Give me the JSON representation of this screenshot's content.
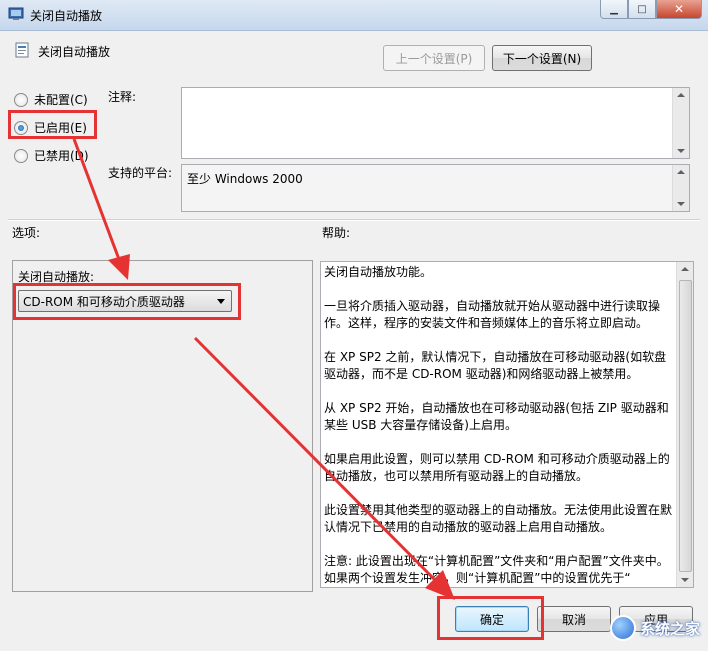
{
  "window": {
    "title": "关闭自动播放"
  },
  "header": {
    "policy_title": "关闭自动播放",
    "prev_label": "上一个设置(P)",
    "next_label": "下一个设置(N)"
  },
  "radios": [
    {
      "label": "未配置(C)",
      "checked": false
    },
    {
      "label": "已启用(E)",
      "checked": true
    },
    {
      "label": "已禁用(D)",
      "checked": false
    }
  ],
  "comment": {
    "label": "注释:",
    "value": ""
  },
  "platform": {
    "label": "支持的平台:",
    "value": "至少 Windows 2000"
  },
  "options": {
    "label": "选项:",
    "dropdown_label": "关闭自动播放:",
    "dropdown_value": "CD-ROM 和可移动介质驱动器"
  },
  "help": {
    "label": "帮助:",
    "paragraphs": [
      "关闭自动播放功能。",
      "一旦将介质插入驱动器，自动播放就开始从驱动器中进行读取操作。这样，程序的安装文件和音频媒体上的音乐将立即启动。",
      "在 XP SP2 之前，默认情况下，自动播放在可移动驱动器(如软盘驱动器，而不是 CD-ROM 驱动器)和网络驱动器上被禁用。",
      "从 XP SP2 开始，自动播放也在可移动驱动器(包括 ZIP 驱动器和某些 USB 大容量存储设备)上启用。",
      "如果启用此设置，则可以禁用 CD-ROM 和可移动介质驱动器上的自动播放，也可以禁用所有驱动器上的自动播放。",
      "此设置禁用其他类型的驱动器上的自动播放。无法使用此设置在默认情况下已禁用的自动播放的驱动器上启用自动播放。",
      "注意: 此设置出现在“计算机配置”文件夹和“用户配置”文件夹中。如果两个设置发生冲突，则“计算机配置”中的设置优先于“"
    ]
  },
  "footer": {
    "ok_label": "确定",
    "cancel_label": "取消",
    "apply_label": "应用"
  },
  "watermark": {
    "text": "系统之家"
  },
  "colors": {
    "annotation_red": "#e53333",
    "titlebar": "#c6d7ec",
    "window_bg": "#f0f0f0"
  }
}
